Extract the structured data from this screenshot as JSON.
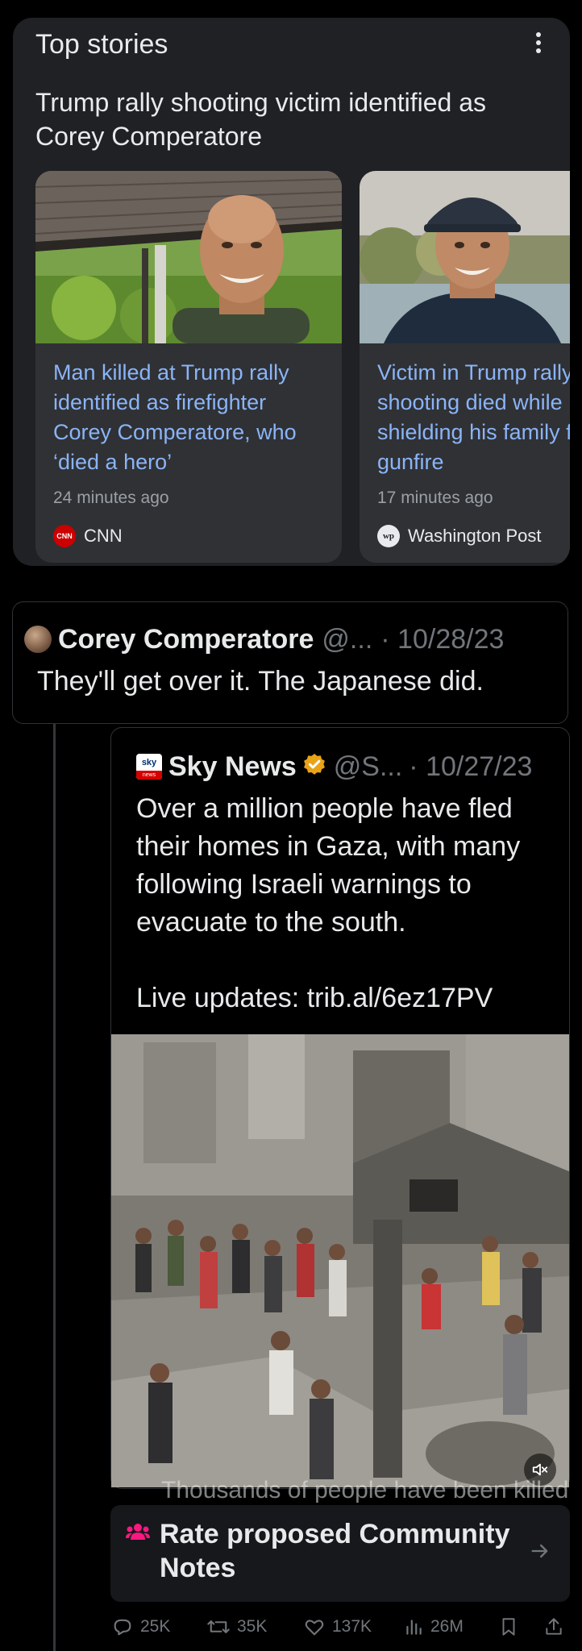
{
  "top_stories": {
    "title": "Top stories",
    "headline": "Trump rally shooting victim identified as Corey Comperatore",
    "stories": [
      {
        "title": "Man killed at Trump rally identified as firefighter Corey Comperatore, who ‘died a hero’",
        "time": "24 minutes ago",
        "source": "CNN",
        "source_logo": "CNN"
      },
      {
        "title": "Victim in Trump rally shooting died while shielding his family from gunfire",
        "time": "17 minutes ago",
        "source": "Washington Post",
        "source_logo": "wp"
      }
    ]
  },
  "tweet": {
    "author": "Corey Comperatore",
    "handle": "@...",
    "date": "· 10/28/23",
    "text": "They'll get over it. The Japanese did."
  },
  "quoted": {
    "author": "Sky News",
    "logo_top": "sky",
    "logo_bottom": "news",
    "handle": "@S...",
    "date": "· 10/27/23",
    "text": "Over a million people have fled their homes in Gaza, with many following Israeli warnings to evacuate to the south.\n\nLive updates: trib.al/6ez17PV",
    "caption": "Thousands of people have been killed"
  },
  "community_notes": {
    "label": "Rate proposed Community Notes",
    "icon": "people-icon",
    "accent": "#f91880"
  },
  "actions": {
    "replies": "25K",
    "retweets": "35K",
    "likes": "137K",
    "views": "26M"
  },
  "colors": {
    "card": "#202124",
    "link": "#8ab4f8",
    "muted": "#71767b",
    "verified": "#e8a317"
  }
}
